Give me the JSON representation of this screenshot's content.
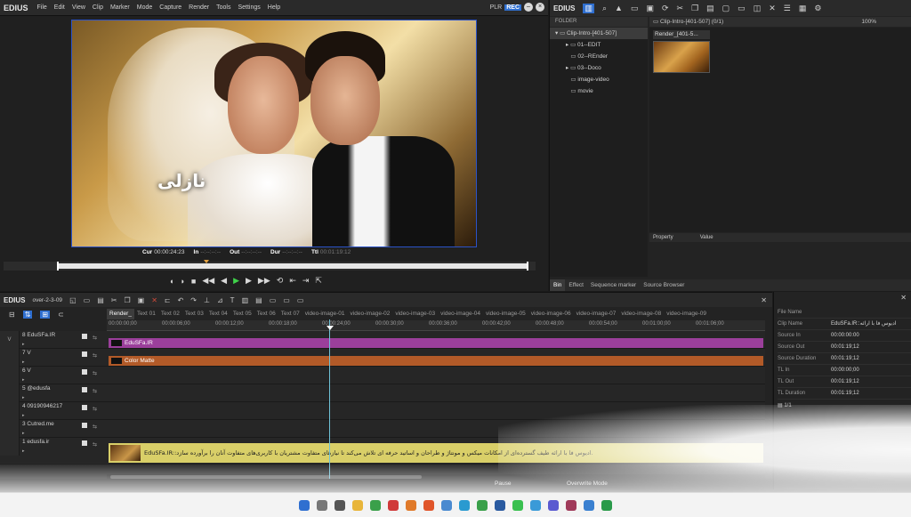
{
  "player": {
    "logo": "EDIUS",
    "menu": [
      "File",
      "Edit",
      "View",
      "Clip",
      "Marker",
      "Mode",
      "Capture",
      "Render",
      "Tools",
      "Settings",
      "Help"
    ],
    "plr_label": "PLR",
    "rec_label": "REC",
    "video_caption": "نازلی",
    "timecodes": {
      "cur_label": "Cur",
      "cur_value": "00:00:24:23",
      "in_label": "In",
      "in_value": "--:--:--:--",
      "out_label": "Out",
      "out_value": "--:--:--:--",
      "dur_label": "Dur",
      "dur_value": "--:--:--:--",
      "ttl_label": "Ttl",
      "ttl_value": "00:01:19:12"
    }
  },
  "bin": {
    "logo": "EDIUS",
    "folder_header": "FOLDER",
    "clip_header": "Clip-Intro-[401-507] (0/1)",
    "zoom": "100%",
    "tree": [
      {
        "label": "Clip-Intro-[401-507]",
        "indent": 0,
        "selected": true,
        "arrow": "▾"
      },
      {
        "label": "01--EDIT",
        "indent": 1,
        "selected": false,
        "arrow": "▸"
      },
      {
        "label": "02--REnder",
        "indent": 1,
        "selected": false,
        "arrow": ""
      },
      {
        "label": "03--Doco",
        "indent": 1,
        "selected": false,
        "arrow": "▸"
      },
      {
        "label": "image-video",
        "indent": 1,
        "selected": false,
        "arrow": ""
      },
      {
        "label": "movie",
        "indent": 1,
        "selected": false,
        "arrow": ""
      }
    ],
    "clip_title": "Render_[401-5...",
    "prop_headers": [
      "Property",
      "Value"
    ],
    "tabs": [
      "Bin",
      "Effect",
      "Sequence marker",
      "Source Browser"
    ]
  },
  "timeline": {
    "logo": "EDIUS",
    "sequence_name": "over-2-3-09",
    "seq_tabs": [
      "Render_",
      "Text 01",
      "Text 02",
      "Text 03",
      "Text 04",
      "Text 05",
      "Text 06",
      "Text 07",
      "video-image-01",
      "video-image-02",
      "video-image-03",
      "video-image-04",
      "video-image-05",
      "video-image-06",
      "video-image-07",
      "video-image-08",
      "video-image-09"
    ],
    "ruler": [
      "00:00:00;00",
      "00:00:06;00",
      "00:00:12;00",
      "00:00:18;00",
      "00:00:24;00",
      "00:00:30;00",
      "00:00:36;00",
      "00:00:42;00",
      "00:00:48;00",
      "00:00:54;00",
      "00:01:00;00",
      "00:01:06;00"
    ],
    "tracks": [
      {
        "label": "8 EduSFa.IR",
        "vcol": "V"
      },
      {
        "label": "7 V",
        "vcol": ""
      },
      {
        "label": "6 V",
        "vcol": ""
      },
      {
        "label": "5 @edusfa",
        "vcol": ""
      },
      {
        "label": "4 09190946217",
        "vcol": ""
      },
      {
        "label": "3 Cutred.me",
        "vcol": ""
      },
      {
        "label": "1 edusfa.ir",
        "vcol": ""
      }
    ],
    "clips": {
      "purple": "EduSFa.IR",
      "orange": "Color Matte",
      "yellow": "EduSFa.IR::ادیوس فا با ارائه طیف گسترده‌ای از امکانات میکس و مونتاژ و طراحان و اساتید حرفه ای تلاش می‌کند تا نیازهای متفاوت مشتریان با کاربری‌های متفاوت آنان را برآورده سازد."
    },
    "status": {
      "pause": "Pause",
      "mode": "Overwrite Mode"
    }
  },
  "info_panel": {
    "rows": [
      {
        "key": "File Name",
        "value": ""
      },
      {
        "key": "Clip Name",
        "value": "EduSFa.IR::ادیوس فا با ارائه"
      },
      {
        "key": "Source In",
        "value": "00:00:00:00"
      },
      {
        "key": "Source Out",
        "value": "00:01:19;12"
      },
      {
        "key": "Source Duration",
        "value": "00:01:19;12"
      },
      {
        "key": "TL In",
        "value": "00:00:00;00"
      },
      {
        "key": "TL Out",
        "value": "00:01:19;12"
      },
      {
        "key": "TL Duration",
        "value": "00:01:19;12"
      }
    ],
    "page": "1/1"
  },
  "taskbar": {
    "icons": [
      "windows-icon",
      "search-icon",
      "task-view-icon",
      "file-explorer-icon",
      "chrome-icon",
      "opera-icon",
      "firefox-icon",
      "brave-icon",
      "browser-icon",
      "edge-icon",
      "chrome2-icon",
      "photoshop-icon",
      "whatsapp-icon",
      "telegram-icon",
      "app-icon",
      "winrar-icon",
      "gallery-icon",
      "media-player-icon"
    ]
  },
  "colors": {
    "accent_blue": "#2f6fd0",
    "clip_purple": "#9b3f9b",
    "clip_orange": "#b25a28",
    "clip_yellow": "#d9cf68",
    "play_green": "#3fd24a"
  }
}
